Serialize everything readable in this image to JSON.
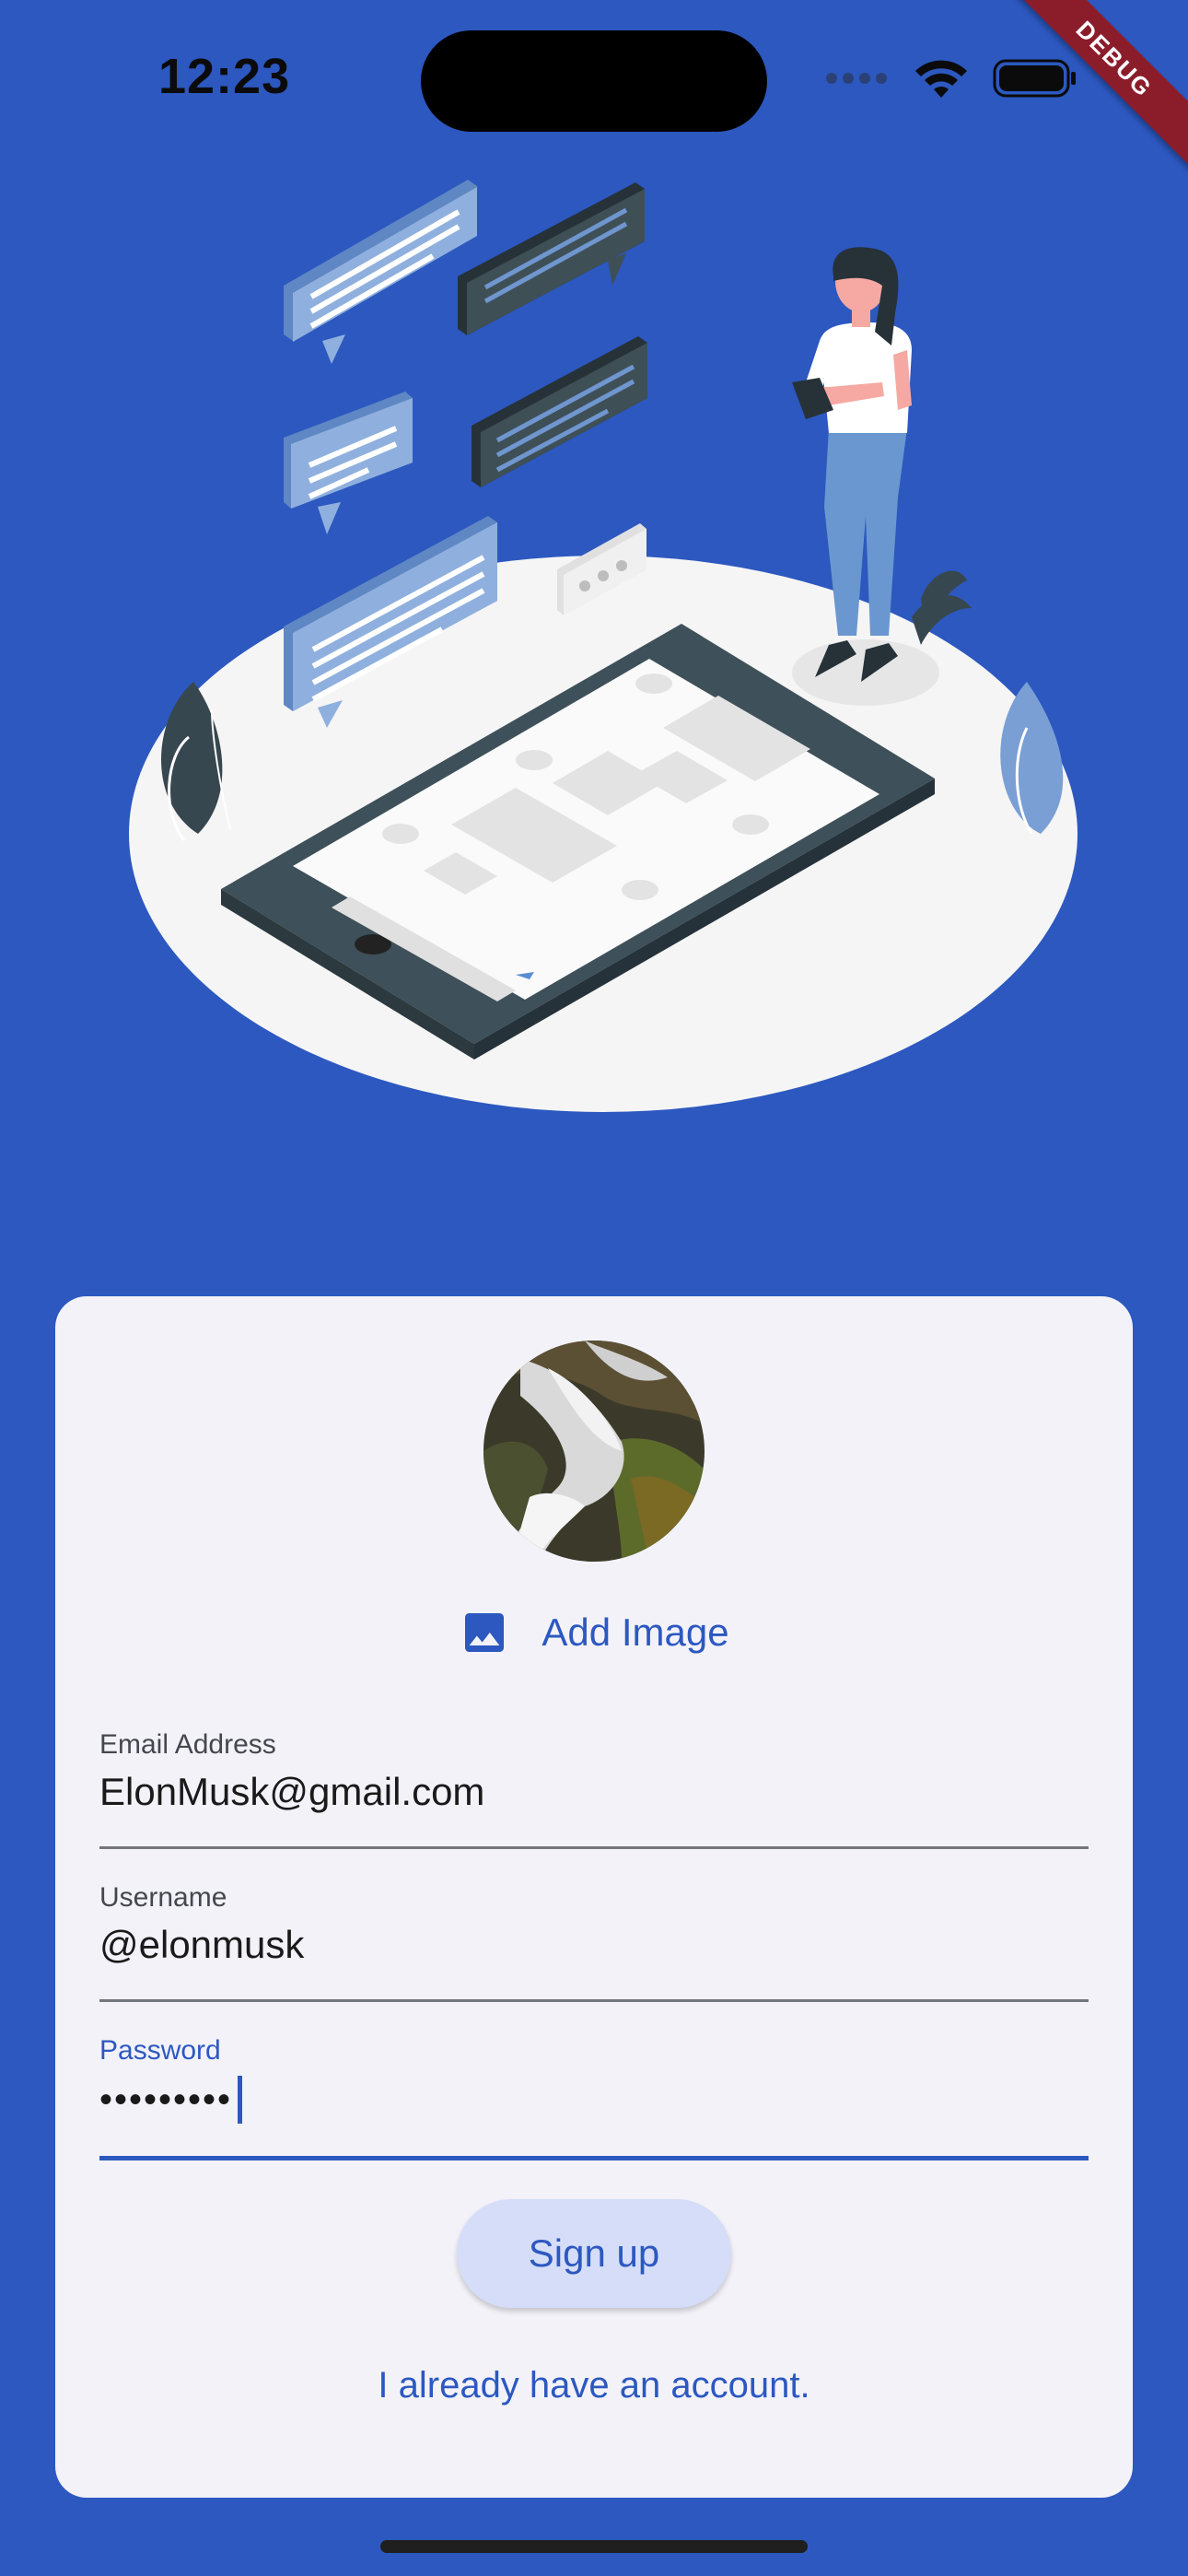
{
  "status_bar": {
    "time": "12:23",
    "debug_label": "DEBUG"
  },
  "form": {
    "add_image_label": "Add Image",
    "email": {
      "label": "Email Address",
      "value": "ElonMusk@gmail.com"
    },
    "username": {
      "label": "Username",
      "value": "@elonmusk"
    },
    "password": {
      "label": "Password",
      "value": "•••••••••"
    },
    "signup_label": "Sign up",
    "login_link": "I already have an account."
  },
  "colors": {
    "background": "#2C58C0",
    "card": "#F3F2F9",
    "accent": "#2C58C0",
    "button_fill": "#D5DDF8"
  },
  "icons": [
    "wifi-icon",
    "battery-icon",
    "image-icon"
  ]
}
